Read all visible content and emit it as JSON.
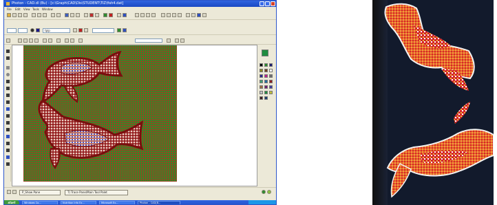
{
  "window": {
    "title": "Photon - CAD.dl (Bu) - [c:\\Graph\\CAD\\Dis\\STUDENT\\TIZ\\fish4.dat]",
    "menu": [
      "File",
      "Edit",
      "View",
      "Tools",
      "Window"
    ]
  },
  "toolbar": {
    "font_select": "tpip",
    "size_select": ""
  },
  "bottom_tabs": {
    "tab1": "P_Show Pane",
    "tab2": "T) Trace Pane/Main Tool Palet"
  },
  "taskbar": {
    "start": "start",
    "tasks": [
      "Windows Co...",
      "Nutrition Info Ex...",
      "Microsoft Ex...",
      "Photon - CAD(B..."
    ]
  },
  "colors": {
    "grid_base": "#2b8e27",
    "grid_lines": "#cd1e1e",
    "fish_outline": "#8a1010",
    "photo_background": "#121a2c",
    "fish_orange": "#e8682a",
    "fish_red": "#d5262a",
    "fish_yellow": "#e8b53a"
  },
  "palette": [
    "#000000",
    "#2c8c2c",
    "#1f1f6f",
    "#8c8c1f",
    "#6f3f1f",
    "#ffffff",
    "#2c2c8c",
    "#c01f8c",
    "#6f6f6f",
    "#3f9f6f",
    "#1f6f9f",
    "#8c1f1f",
    "#9f6f3f",
    "#6f1f6f",
    "#3f3f9f",
    "#c0c0c0",
    "#1f8c3f",
    "#bfbf3f",
    "#3f1f1f",
    "#1f3f6f"
  ]
}
